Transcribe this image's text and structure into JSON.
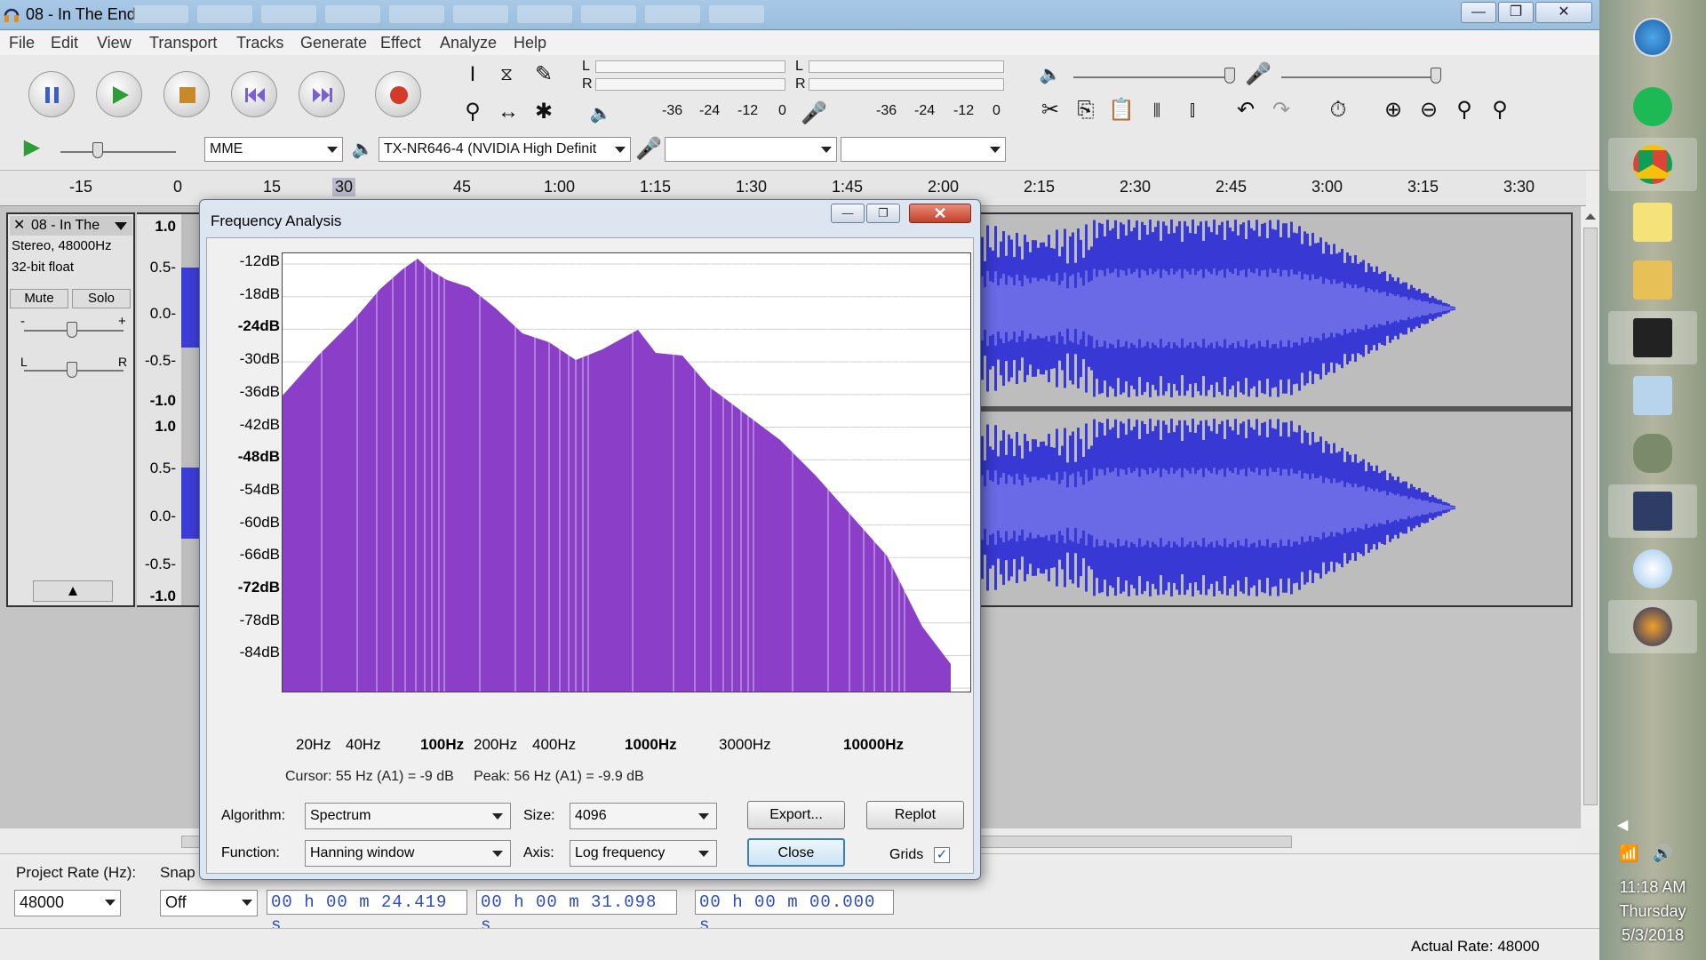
{
  "window": {
    "title": "08 - In The End",
    "min": "—",
    "max": "❐",
    "close": "✕"
  },
  "menu": [
    "File",
    "Edit",
    "View",
    "Transport",
    "Tracks",
    "Generate",
    "Effect",
    "Analyze",
    "Help"
  ],
  "meters": {
    "rec_l": "L",
    "rec_r": "R",
    "play_l": "L",
    "play_r": "R",
    "scale": [
      "-36",
      "-24",
      "-12",
      "0"
    ]
  },
  "device": {
    "host": "MME",
    "output": "TX-NR646-4 (NVIDIA High Definit",
    "input": "",
    "channels": ""
  },
  "ruler": [
    "-15",
    "0",
    "15",
    "30",
    "45",
    "1:00",
    "1:15",
    "1:30",
    "1:45",
    "2:00",
    "2:15",
    "2:30",
    "2:45",
    "3:00",
    "3:15",
    "3:30"
  ],
  "track": {
    "name": "08 - In The",
    "close": "✕",
    "info1": "Stereo, 48000Hz",
    "info2": "32-bit float",
    "mute": "Mute",
    "solo": "Solo",
    "gain_minus": "-",
    "gain_plus": "+",
    "pan_l": "L",
    "pan_r": "R",
    "scale": [
      "1.0",
      "0.5-",
      "0.0-",
      "-0.5-",
      "-1.0",
      "1.0",
      "0.5-",
      "0.0-",
      "-0.5-",
      "-1.0"
    ]
  },
  "bottom": {
    "project_rate_label": "Project Rate (Hz):",
    "project_rate": "48000",
    "snap_label": "Snap",
    "snap_value": "Off",
    "sel_start": "00 h 00 m 24.419 s",
    "sel_end": "00 h 00 m 31.098 s",
    "audio_pos": "00 h 00 m 00.000 s"
  },
  "status": {
    "actual_rate": "Actual Rate: 48000"
  },
  "dialog": {
    "title": "Frequency Analysis",
    "db_labels": [
      "-12dB",
      "-18dB",
      "-24dB",
      "-30dB",
      "-36dB",
      "-42dB",
      "-48dB",
      "-54dB",
      "-60dB",
      "-66dB",
      "-72dB",
      "-78dB",
      "-84dB"
    ],
    "hz_labels": [
      "20Hz",
      "40Hz",
      "100Hz",
      "200Hz",
      "400Hz",
      "1000Hz",
      "3000Hz",
      "10000Hz"
    ],
    "cursor_text": "Cursor: 55 Hz (A1) = -9 dB",
    "peak_text": "Peak: 56 Hz (A1) = -9.9 dB",
    "algorithm_label": "Algorithm:",
    "algorithm": "Spectrum",
    "size_label": "Size:",
    "size": "4096",
    "function_label": "Function:",
    "function": "Hanning window",
    "axis_label": "Axis:",
    "axis": "Log frequency",
    "export_btn": "Export...",
    "replot_btn": "Replot",
    "close_btn": "Close",
    "grids_label": "Grids",
    "grids_checked": "✓",
    "fill_color": "#8b3fc9"
  },
  "clock": {
    "time": "11:18 AM",
    "day": "Thursday",
    "date": "5/3/2018"
  }
}
